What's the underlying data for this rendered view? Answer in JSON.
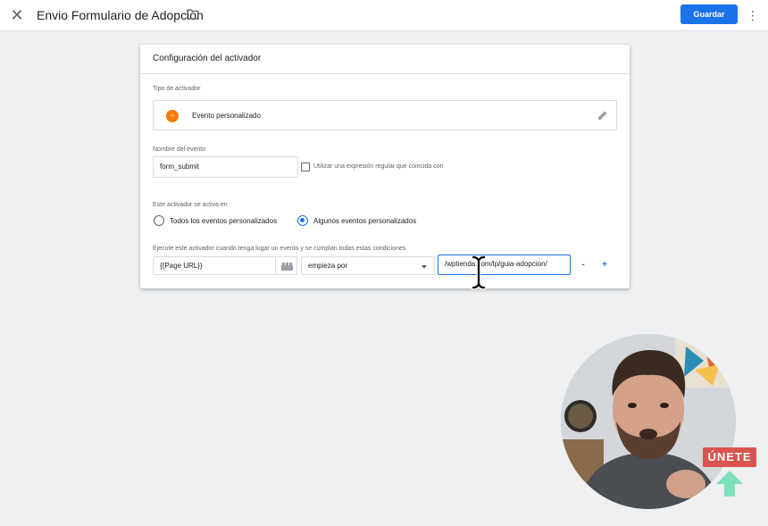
{
  "header": {
    "title": "Envio Formulario de Adopción",
    "save_label": "Guardar",
    "close_icon": "close-icon",
    "folder_icon": "folder-icon",
    "more_icon": "more-vert-icon"
  },
  "trigger": {
    "card_title": "Configuración del activador",
    "type_label": "Tipo de activador",
    "type_value": "Evento personalizado",
    "type_icon_glyph": "‹›",
    "event_name_label": "Nombre del evento",
    "event_name_value": "form_submit",
    "regex_checkbox_label": "Utilizar una expresión regular que coincida con",
    "fires_on_label": "Este activador se activa en",
    "radio_all": "Todos los eventos personalizados",
    "radio_some": "Algunos eventos personalizados",
    "selected_radio": "some",
    "condition_label": "Ejecute este activador cuando tenga lugar un evento y se cumplan todas estas condiciones",
    "condition": {
      "variable": "{{Page URL}}",
      "operator": "empieza por",
      "value": "/wptienda.com/lp/guia-adopcion/"
    },
    "minus_label": "-",
    "plus_label": "+"
  },
  "overlay": {
    "badge_text": "ÚNETE"
  },
  "colors": {
    "primary": "#1a73e8",
    "event_icon": "#f57c00",
    "badge": "#d9534f",
    "badge_arrow": "#7fe0b9"
  }
}
